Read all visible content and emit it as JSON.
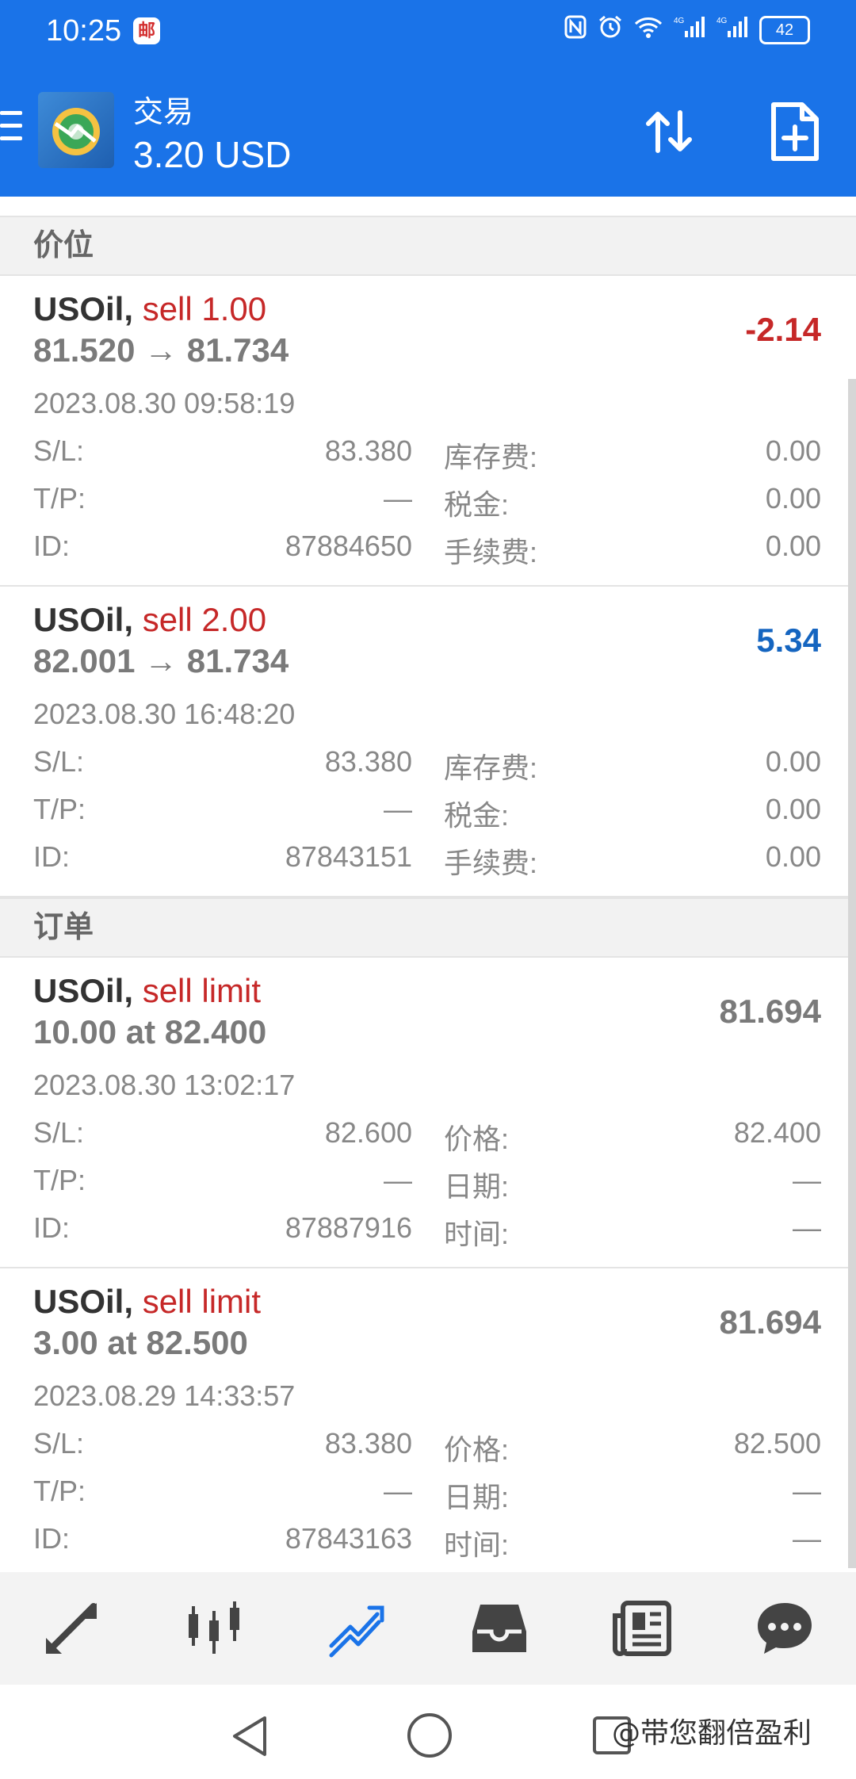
{
  "status_bar": {
    "time": "10:25",
    "mail_badge": "邮",
    "battery": "42",
    "net1": "4G",
    "net2": "4G"
  },
  "app_bar": {
    "title": "交易",
    "balance": "3.20 USD"
  },
  "sections": {
    "positions_header": "价位",
    "orders_header": "订单"
  },
  "positions": [
    {
      "symbol": "USOil,",
      "type": "sell 1.00",
      "prices": "81.520 → 81.734",
      "profit": "-2.14",
      "time": "2023.08.30 09:58:19",
      "sl_label": "S/L:",
      "sl": "83.380",
      "tp_label": "T/P:",
      "tp": "—",
      "id_label": "ID:",
      "id": "87884650",
      "swap_label": "库存费:",
      "swap": "0.00",
      "tax_label": "税金:",
      "tax": "0.00",
      "fee_label": "手续费:",
      "fee": "0.00"
    },
    {
      "symbol": "USOil,",
      "type": "sell 2.00",
      "prices": "82.001 → 81.734",
      "profit": "5.34",
      "time": "2023.08.30 16:48:20",
      "sl_label": "S/L:",
      "sl": "83.380",
      "tp_label": "T/P:",
      "tp": "—",
      "id_label": "ID:",
      "id": "87843151",
      "swap_label": "库存费:",
      "swap": "0.00",
      "tax_label": "税金:",
      "tax": "0.00",
      "fee_label": "手续费:",
      "fee": "0.00"
    }
  ],
  "orders": [
    {
      "symbol": "USOil,",
      "type": "sell limit",
      "volume_price": "10.00 at 82.400",
      "current": "81.694",
      "time": "2023.08.30 13:02:17",
      "sl_label": "S/L:",
      "sl": "82.600",
      "tp_label": "T/P:",
      "tp": "—",
      "id_label": "ID:",
      "id": "87887916",
      "price_label": "价格:",
      "price": "82.400",
      "date_label": "日期:",
      "date": "—",
      "tm_label": "时间:",
      "tm": "—"
    },
    {
      "symbol": "USOil,",
      "type": "sell limit",
      "volume_price": "3.00 at 82.500",
      "current": "81.694",
      "time": "2023.08.29 14:33:57",
      "sl_label": "S/L:",
      "sl": "83.380",
      "tp_label": "T/P:",
      "tp": "—",
      "id_label": "ID:",
      "id": "87843163",
      "price_label": "价格:",
      "price": "82.500",
      "date_label": "日期:",
      "date": "—",
      "tm_label": "时间:",
      "tm": "—"
    }
  ],
  "bottom_nav": [
    {
      "icon": "quotes-icon"
    },
    {
      "icon": "chart-icon"
    },
    {
      "icon": "trade-icon"
    },
    {
      "icon": "history-icon"
    },
    {
      "icon": "news-icon"
    },
    {
      "icon": "chat-icon"
    }
  ],
  "watermark": "@带您翻倍盈利",
  "colors": {
    "app_bar": "#1a73e8",
    "sell": "#c62828",
    "profit_negative": "#c62828",
    "profit_positive": "#1565c0",
    "nav_active": "#1a73e8"
  }
}
